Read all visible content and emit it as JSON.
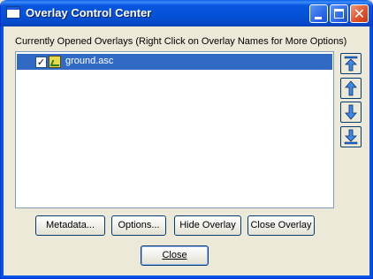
{
  "window": {
    "title": "Overlay Control Center",
    "title_icon": "window-icon",
    "controls": {
      "minimize_icon": "minimize-icon",
      "maximize_icon": "maximize-icon",
      "close_icon": "close-icon"
    }
  },
  "caption": "Currently Opened Overlays (Right Click on Overlay Names for More Options)",
  "overlays": [
    {
      "name": "ground.asc",
      "checked": true,
      "selected": true,
      "icon": "raster-layer-icon"
    }
  ],
  "order_buttons": [
    {
      "icon": "move-to-top-icon"
    },
    {
      "icon": "move-up-icon"
    },
    {
      "icon": "move-down-icon"
    },
    {
      "icon": "move-to-bottom-icon"
    }
  ],
  "buttons": {
    "metadata": "Metadata...",
    "options": "Options...",
    "hide_overlay": "Hide Overlay",
    "close_overlay": "Close Overlay",
    "close": "Close"
  },
  "colors": {
    "titlebar": "#0554d6",
    "selection": "#316ac5",
    "dialog_bg": "#ece9d8",
    "arrow_blue": "#1e6fd9"
  }
}
